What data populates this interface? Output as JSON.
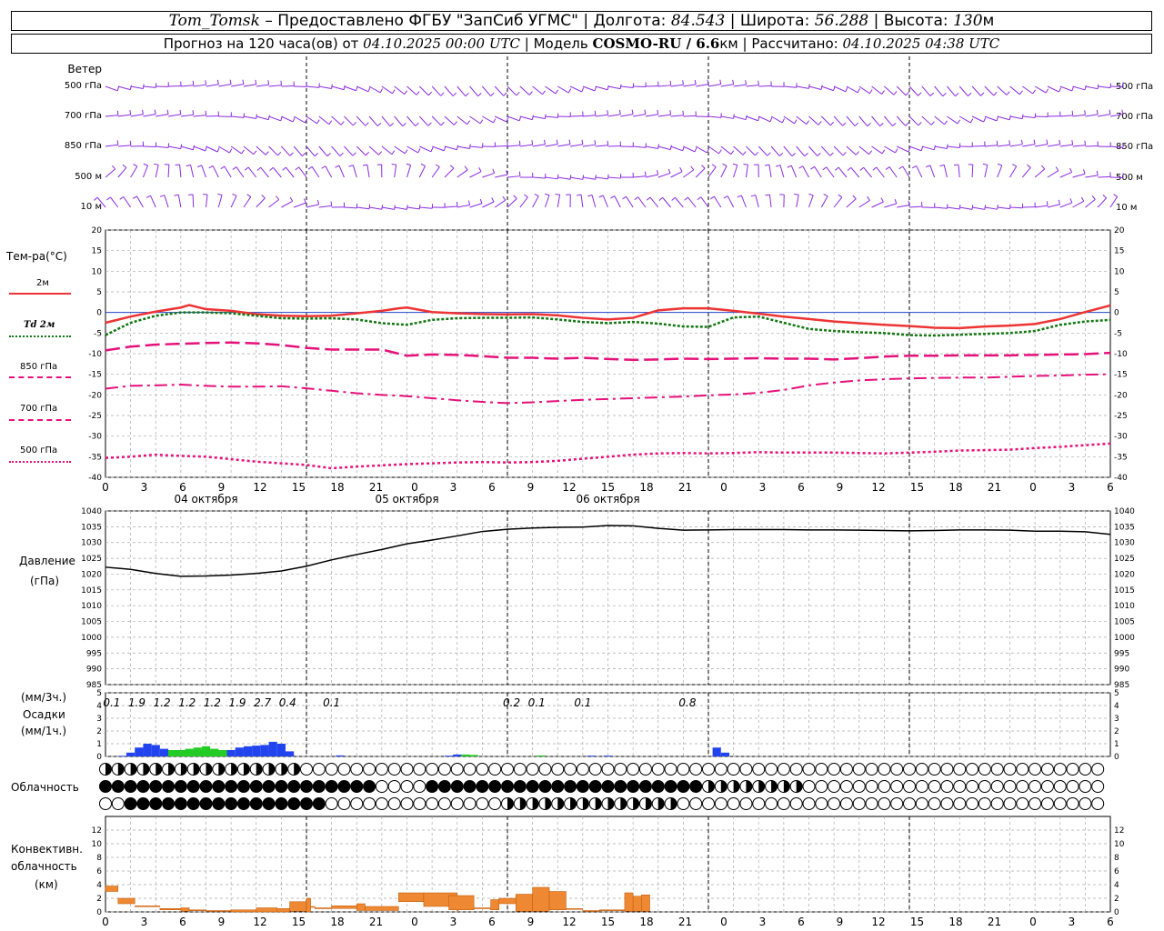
{
  "header": {
    "station": "Tom_Tomsk",
    "provider": "– Предоставлено ФГБУ \"ЗапСиб УГМС\"",
    "lon_label": "Долгота:",
    "lon": "84.543",
    "lat_label": "Широта:",
    "lat": "56.288",
    "alt_label": "Высота:",
    "alt": "130",
    "alt_unit": "м",
    "sep": "|",
    "forecast_prefix": "Прогноз на 120 часа(ов) от",
    "forecast_start": "04.10.2025 00:00 UTC",
    "model_label": "Модель",
    "model": "COSMO-RU / 6.6",
    "model_unit": "км",
    "calc_label": "Рассчитано:",
    "calc_time": "04.10.2025 04:38 UTC"
  },
  "labels": {
    "wind": "Ветер",
    "wind_levels": [
      "500 гПа",
      "700 гПа",
      "850 гПа",
      "500 м",
      "10 м"
    ],
    "temp_title": "Тем-ра(°C)",
    "temp_legend": [
      "2м",
      "Td 2м",
      "850 гПа",
      "700 гПа",
      "500 гПа"
    ],
    "pressure_title": "Давление",
    "pressure_unit": "(гПа)",
    "precip_unit3": "(мм/3ч.)",
    "precip_title": "Осадки",
    "precip_unit1": "(мм/1ч.)",
    "cloud_title": "Облачность",
    "conv_title": [
      "Конвективн.",
      "облачность",
      "(км)"
    ]
  },
  "colors": {
    "wind": "#8a2be2",
    "t2m": "#ee3333",
    "td2m": "#117711",
    "t850": "#e6107a",
    "t700": "#e6107a",
    "t500": "#e6107a",
    "precip_blue": "#2244ee",
    "precip_green": "#22cc22",
    "conv": "#ee8833",
    "grid": "#aaaaaa"
  },
  "chart_data": [
    {
      "type": "line",
      "title": "Тем-ра(°C)",
      "ylabel": "°C",
      "ylim": [
        -40,
        20
      ],
      "yticks": [
        -40,
        -35,
        -30,
        -25,
        -20,
        -15,
        -10,
        -5,
        0,
        5,
        10,
        15,
        20
      ],
      "xlim_hours": [
        0,
        120
      ],
      "x_tick_labels": [
        "0",
        "3",
        "6",
        "9",
        "12",
        "15",
        "18",
        "21",
        "0",
        "3",
        "6",
        "9",
        "12",
        "15",
        "18",
        "21",
        "0",
        "3",
        "6",
        "9",
        "12",
        "15",
        "18",
        "21",
        "0",
        "3",
        "6"
      ],
      "day_labels": [
        "04 октября",
        "05 октября",
        "06 октября"
      ],
      "series": [
        {
          "name": "2м",
          "x": [
            0,
            3,
            6,
            9,
            10,
            12,
            15,
            18,
            21,
            24,
            27,
            30,
            33,
            35,
            36,
            39,
            42,
            45,
            48,
            51,
            54,
            57,
            60,
            63,
            66,
            69,
            72,
            75,
            78,
            81,
            84,
            87,
            90,
            93,
            96,
            99,
            102,
            105,
            108,
            111,
            114,
            117,
            120
          ],
          "values": [
            -2.5,
            -1,
            0.2,
            1.2,
            1.8,
            0.8,
            0.4,
            -0.4,
            -0.8,
            -0.9,
            -0.8,
            -0.2,
            0.4,
            1.0,
            1.2,
            0.1,
            -0.2,
            -0.4,
            -0.5,
            -0.4,
            -0.7,
            -1.3,
            -1.7,
            -1.3,
            0.5,
            1.0,
            1.0,
            0.4,
            -0.3,
            -1.0,
            -1.6,
            -2.2,
            -2.6,
            -3.0,
            -3.3,
            -3.7,
            -3.8,
            -3.4,
            -3.2,
            -2.8,
            -1.6,
            0.1,
            1.7
          ]
        },
        {
          "name": "Td 2м",
          "x": [
            0,
            3,
            6,
            9,
            12,
            15,
            18,
            21,
            24,
            27,
            30,
            33,
            36,
            39,
            42,
            45,
            48,
            51,
            54,
            57,
            60,
            63,
            66,
            69,
            72,
            75,
            78,
            81,
            84,
            87,
            90,
            93,
            96,
            99,
            102,
            105,
            108,
            111,
            114,
            117,
            120
          ],
          "values": [
            -5.5,
            -2.5,
            -0.8,
            0.0,
            0.0,
            -0.2,
            -0.8,
            -1.4,
            -1.5,
            -1.4,
            -1.7,
            -2.6,
            -3.0,
            -1.8,
            -1.4,
            -1.3,
            -1.3,
            -1.2,
            -1.7,
            -2.3,
            -2.6,
            -2.3,
            -2.7,
            -3.4,
            -3.5,
            -1.2,
            -1.0,
            -2.5,
            -4.0,
            -4.5,
            -4.8,
            -5.0,
            -5.5,
            -5.6,
            -5.4,
            -5.2,
            -5.0,
            -4.5,
            -3.0,
            -2.2,
            -1.8
          ]
        },
        {
          "name": "850 гПа",
          "x": [
            0,
            3,
            6,
            9,
            12,
            15,
            18,
            21,
            24,
            27,
            30,
            33,
            36,
            39,
            42,
            45,
            48,
            51,
            54,
            57,
            60,
            63,
            66,
            69,
            72,
            75,
            78,
            81,
            84,
            87,
            90,
            93,
            96,
            99,
            102,
            105,
            108,
            111,
            114,
            117,
            120
          ],
          "values": [
            -9.2,
            -8.3,
            -7.8,
            -7.6,
            -7.4,
            -7.3,
            -7.5,
            -7.9,
            -8.6,
            -9.0,
            -9.0,
            -9.0,
            -10.5,
            -10.2,
            -10.3,
            -10.6,
            -11.0,
            -11.0,
            -11.2,
            -11.0,
            -11.3,
            -11.5,
            -11.4,
            -11.2,
            -11.3,
            -11.2,
            -11.1,
            -11.2,
            -11.2,
            -11.4,
            -11.1,
            -10.7,
            -10.5,
            -10.5,
            -10.4,
            -10.4,
            -10.4,
            -10.3,
            -10.2,
            -10.1,
            -9.8
          ]
        },
        {
          "name": "700 гПа",
          "x": [
            0,
            3,
            6,
            9,
            12,
            15,
            18,
            21,
            24,
            27,
            30,
            33,
            36,
            39,
            42,
            45,
            48,
            51,
            54,
            57,
            60,
            63,
            66,
            69,
            72,
            75,
            78,
            81,
            84,
            87,
            90,
            93,
            96,
            99,
            102,
            105,
            108,
            111,
            114,
            117,
            120
          ],
          "values": [
            -18.5,
            -17.8,
            -17.7,
            -17.5,
            -17.8,
            -18.0,
            -18.0,
            -17.9,
            -18.4,
            -19.0,
            -19.6,
            -20.0,
            -20.3,
            -20.8,
            -21.3,
            -21.7,
            -22.0,
            -21.8,
            -21.5,
            -21.2,
            -21.0,
            -20.8,
            -20.6,
            -20.4,
            -20.1,
            -19.9,
            -19.5,
            -18.8,
            -17.7,
            -17.0,
            -16.5,
            -16.2,
            -16.0,
            -15.9,
            -15.8,
            -15.8,
            -15.6,
            -15.4,
            -15.3,
            -15.1,
            -15.0
          ]
        },
        {
          "name": "500 гПа",
          "x": [
            0,
            3,
            6,
            9,
            12,
            15,
            18,
            21,
            24,
            27,
            30,
            33,
            36,
            39,
            42,
            45,
            48,
            51,
            54,
            57,
            60,
            63,
            66,
            69,
            72,
            75,
            78,
            81,
            84,
            87,
            90,
            93,
            96,
            99,
            102,
            105,
            108,
            111,
            114,
            117,
            120
          ],
          "values": [
            -35.3,
            -35.0,
            -34.5,
            -34.8,
            -35.0,
            -35.6,
            -36.2,
            -36.6,
            -37.0,
            -37.8,
            -37.4,
            -37.1,
            -36.8,
            -36.6,
            -36.4,
            -36.3,
            -36.4,
            -36.3,
            -36.0,
            -35.5,
            -35.0,
            -34.5,
            -34.2,
            -34.1,
            -34.2,
            -34.1,
            -33.9,
            -34.0,
            -34.0,
            -34.0,
            -34.1,
            -34.2,
            -34.0,
            -33.8,
            -33.5,
            -33.4,
            -33.3,
            -32.9,
            -32.6,
            -32.2,
            -31.8
          ]
        }
      ]
    },
    {
      "type": "line",
      "title": "Давление",
      "ylabel": "(гПа)",
      "ylim": [
        985,
        1040
      ],
      "yticks": [
        985,
        990,
        995,
        1000,
        1005,
        1010,
        1015,
        1020,
        1025,
        1030,
        1035,
        1040
      ],
      "series": [
        {
          "name": "",
          "x": [
            0,
            3,
            6,
            9,
            12,
            15,
            18,
            21,
            24,
            27,
            30,
            33,
            36,
            39,
            42,
            45,
            48,
            51,
            54,
            57,
            60,
            63,
            66,
            69,
            72,
            75,
            78,
            81,
            84,
            87,
            90,
            93,
            96,
            99,
            102,
            105,
            108,
            111,
            114,
            117,
            120
          ],
          "values": [
            1022.2,
            1021.5,
            1020.2,
            1019.3,
            1019.4,
            1019.7,
            1020.2,
            1021.0,
            1022.5,
            1024.5,
            1026.2,
            1027.8,
            1029.6,
            1030.8,
            1032.1,
            1033.5,
            1034.2,
            1034.6,
            1034.8,
            1034.9,
            1035.4,
            1035.3,
            1034.5,
            1033.9,
            1034.0,
            1034.1,
            1034.1,
            1034.1,
            1034.0,
            1034.0,
            1033.9,
            1033.8,
            1033.7,
            1033.8,
            1034.0,
            1034.0,
            1033.9,
            1033.6,
            1033.6,
            1033.4,
            1032.6
          ]
        }
      ]
    },
    {
      "type": "bar",
      "title": "Осадки",
      "ylabel": "(мм/1ч.)",
      "ylim": [
        0,
        5
      ],
      "yticks": [
        0,
        1,
        2,
        3,
        4,
        5
      ],
      "totals_3h_x": [
        0.75,
        3.75,
        6.75,
        9.75,
        12.75,
        15.75,
        18.75,
        21.75,
        27,
        48.5,
        51.5,
        57,
        69.5
      ],
      "totals_3h": [
        "0.1",
        "1.9",
        "1.2",
        "1.2",
        "1.2",
        "1.9",
        "2.7",
        "0.4",
        "0.1",
        "0.2",
        "0.1",
        "0.1",
        "0.8"
      ],
      "series": [
        {
          "name": "blue",
          "x": [
            2,
            3,
            4,
            5,
            6,
            7,
            8,
            9,
            10,
            11,
            12,
            13,
            14,
            15,
            16,
            17,
            18,
            19,
            20,
            21,
            22,
            28,
            41,
            42,
            58,
            60,
            73,
            74
          ],
          "values": [
            0.05,
            0.3,
            0.7,
            1.0,
            0.9,
            0.6,
            0.5,
            0.5,
            0.5,
            0.5,
            0.4,
            0.4,
            0.5,
            0.5,
            0.7,
            0.8,
            0.85,
            0.9,
            1.15,
            1.0,
            0.4,
            0.08,
            0.06,
            0.15,
            0.06,
            0.06,
            0.7,
            0.3
          ]
        },
        {
          "name": "green",
          "x": [
            8,
            9,
            10,
            11,
            12,
            13,
            14,
            43,
            44,
            52
          ],
          "values": [
            0.5,
            0.5,
            0.6,
            0.7,
            0.8,
            0.6,
            0.5,
            0.15,
            0.12,
            0.08
          ]
        }
      ]
    },
    {
      "type": "bar",
      "title": "Конвективн. облачность",
      "ylabel": "(км)",
      "ylim": [
        0,
        14
      ],
      "yticks": [
        0,
        2,
        4,
        6,
        8,
        10,
        12
      ],
      "series": [
        {
          "name": "",
          "bars_bottom": [
            3.0,
            1.2,
            1.3,
            0.3,
            0.1,
            0.2,
            0.1,
            0,
            0,
            0,
            0.1,
            0,
            1.5,
            2.1,
            0.5,
            0.2,
            0.2,
            1.5,
            0.8,
            0.5,
            0.3,
            1.0,
            0.3,
            1.2,
            0.1,
            0.1,
            0.3,
            2.1,
            0.7,
            0.3,
            0.1,
            0.1,
            0.1
          ],
          "x_start": [
            0,
            1.5,
            3.5,
            6.5,
            9,
            10,
            12,
            15,
            18,
            20.5,
            22,
            24,
            24.5,
            25,
            27,
            30,
            31,
            35,
            38,
            42,
            41,
            44,
            46,
            47,
            49,
            51,
            53,
            55,
            57,
            59,
            62,
            63,
            64
          ],
          "x_end": [
            1.5,
            3.5,
            6.5,
            9,
            10,
            12,
            15,
            18,
            20.5,
            22,
            24,
            24.5,
            25,
            27,
            30,
            31,
            35,
            38,
            42,
            41,
            44,
            46,
            47,
            49,
            51,
            53,
            55,
            57,
            59,
            62,
            63,
            64,
            65
          ],
          "values": [
            3.8,
            2.0,
            0.9,
            0.5,
            0.6,
            0.3,
            0.2,
            0.3,
            0.6,
            0.5,
            1.5,
            2.0,
            0.8,
            0.6,
            0.9,
            1.2,
            0.8,
            2.8,
            2.8,
            0.3,
            2.4,
            0.6,
            1.8,
            2.0,
            2.6,
            3.6,
            3.0,
            0.5,
            0.2,
            0.3,
            2.8,
            2.3,
            2.5
          ]
        }
      ]
    }
  ]
}
